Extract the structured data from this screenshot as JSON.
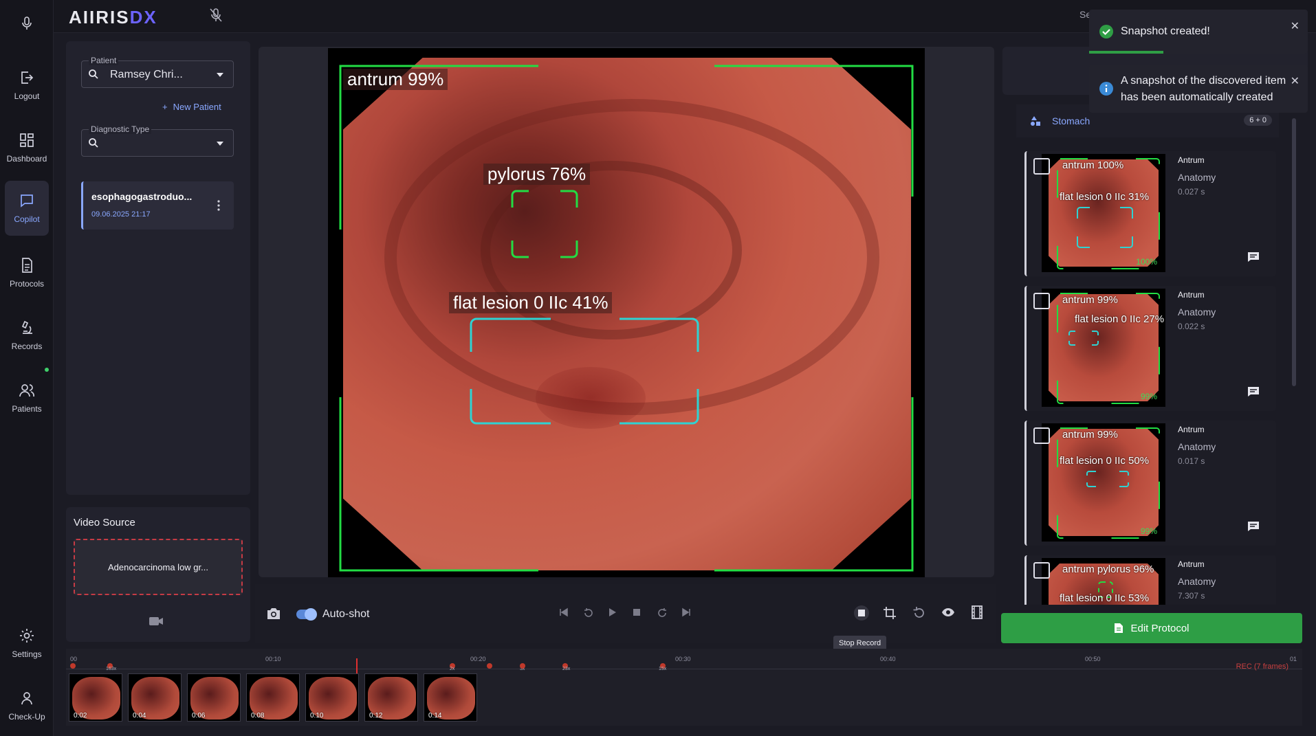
{
  "app": {
    "logo_part1": "AIIRIS",
    "logo_part2": "DX",
    "topbar_search_stub": "Se"
  },
  "nav": [
    {
      "id": "logout",
      "label": "Logout"
    },
    {
      "id": "dashboard",
      "label": "Dashboard"
    },
    {
      "id": "copilot",
      "label": "Copilot",
      "active": true
    },
    {
      "id": "protocols",
      "label": "Protocols"
    },
    {
      "id": "records",
      "label": "Records"
    },
    {
      "id": "patients",
      "label": "Patients"
    },
    {
      "id": "settings",
      "label": "Settings"
    },
    {
      "id": "checkup",
      "label": "Check-Up"
    }
  ],
  "patient_panel": {
    "patient_label": "Patient",
    "patient_value": "Ramsey Chri...",
    "new_patient": "New Patient",
    "diagnostic_type_label": "Diagnostic Type",
    "study": {
      "title": "esophagogastroduo...",
      "date": "09.06.2025 21:17"
    }
  },
  "video_source": {
    "title": "Video Source",
    "source_name": "Adenocarcinoma low gr..."
  },
  "detections": [
    {
      "label": "antrum 99%",
      "color": "#22dd44"
    },
    {
      "label": "pylorus 76%",
      "color": "#22dd44"
    },
    {
      "label": "flat lesion 0 IIc 41%",
      "color": "#2ed3d3"
    }
  ],
  "controls": {
    "autoshot_label": "Auto-shot",
    "autoshot_on": true,
    "tooltip": "Stop Record"
  },
  "right_panel": {
    "section": "Stomach",
    "count": "6 + 0",
    "snapshots": [
      {
        "labels": [
          "antrum 100%",
          "flat lesion 0 IIc 31%"
        ],
        "pct": "100%",
        "location": "Antrum",
        "category": "Anatomy",
        "time": "0.027 s"
      },
      {
        "labels": [
          "antrum 99%",
          "flat lesion 0 IIc 27%"
        ],
        "pct": "99%",
        "location": "Antrum",
        "category": "Anatomy",
        "time": "0.022 s"
      },
      {
        "labels": [
          "antrum 99%",
          "flat lesion 0 IIc 50%"
        ],
        "pct": "99%",
        "location": "Antrum",
        "category": "Anatomy",
        "time": "0.017 s"
      },
      {
        "labels": [
          "antrum pylorus 96%",
          "flat lesion 0 IIc 53%"
        ],
        "pct": "",
        "location": "Antrum",
        "category": "Anatomy",
        "time": "7.307 s"
      }
    ],
    "edit_protocol": "Edit Protocol"
  },
  "toasts": [
    {
      "type": "success",
      "message": "Snapshot created!"
    },
    {
      "type": "info",
      "message": "A snapshot of the discovered item has been automatically created"
    }
  ],
  "timeline": {
    "ticks": [
      "00",
      "00:10",
      "00:20",
      "00:30",
      "00:40",
      "00:50",
      "01"
    ],
    "markers": [
      "163x",
      "2x",
      "3x",
      "23x",
      "15x"
    ],
    "rec_label": "REC (7 frames)",
    "frames": [
      "0:02",
      "0:04",
      "0:06",
      "0:08",
      "0:10",
      "0:12",
      "0:14"
    ]
  }
}
